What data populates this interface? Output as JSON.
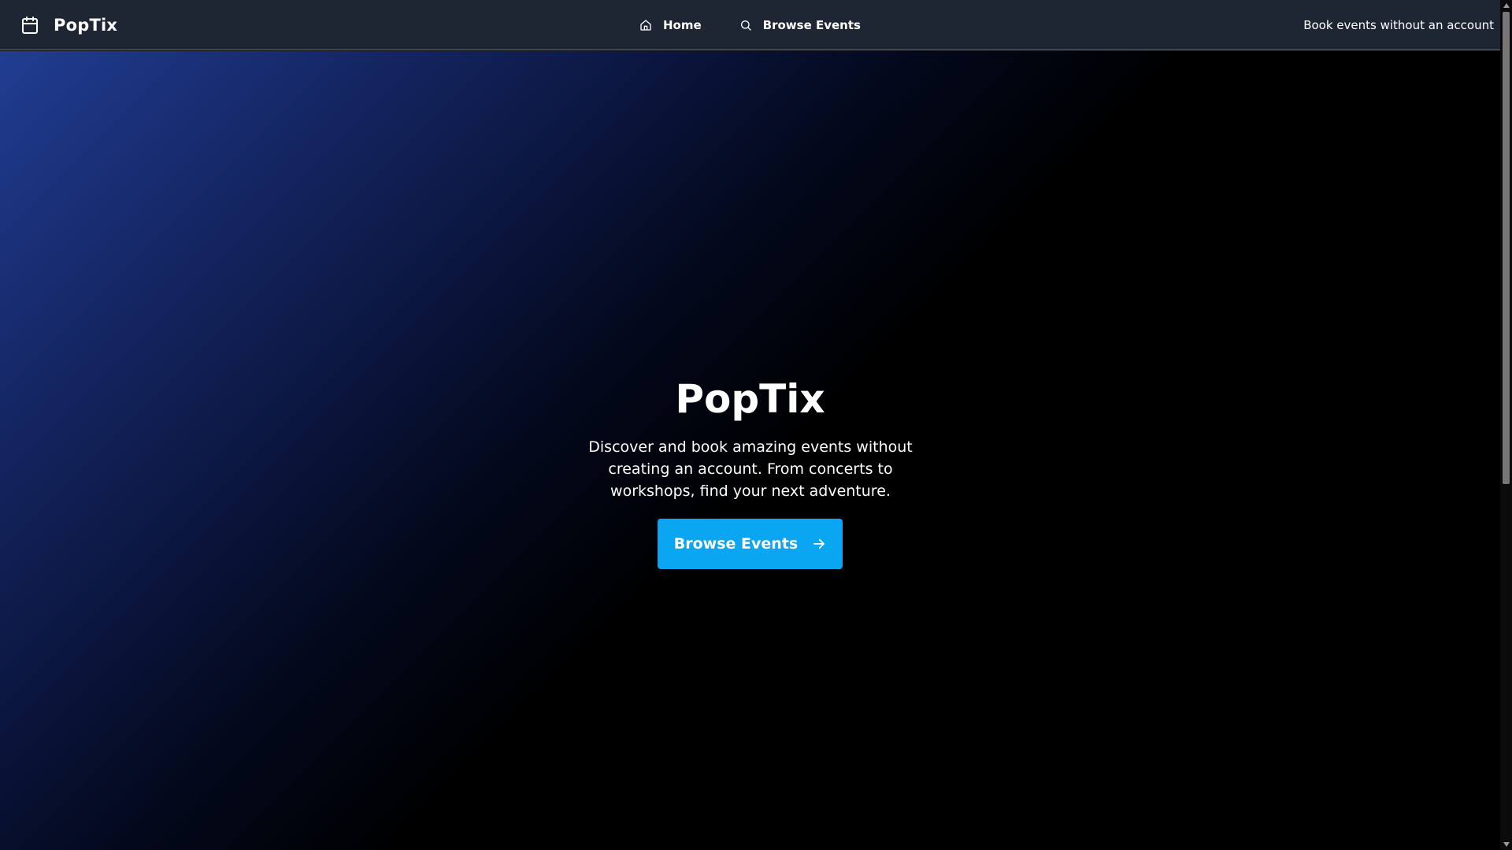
{
  "nav": {
    "brand_icon": "calendar-icon",
    "brand_name": "PopTix",
    "links": [
      {
        "label": "Home",
        "icon": "home-icon"
      },
      {
        "label": "Browse Events",
        "icon": "search-icon"
      }
    ],
    "tagline": "Book events without an account"
  },
  "hero": {
    "title": "PopTix",
    "description": "Discover and book amazing events without creating an account. From concerts to workshops, find your next adventure.",
    "cta_label": "Browse Events",
    "cta_icon": "arrow-right-icon"
  },
  "colors": {
    "navbar_bg": "#1e2533",
    "navbar_border": "#2b8fd6",
    "cta_bg": "#0aa6f1",
    "hero_gradient_start": "#213d92",
    "hero_gradient_end": "#000000",
    "text": "#ffffff"
  }
}
